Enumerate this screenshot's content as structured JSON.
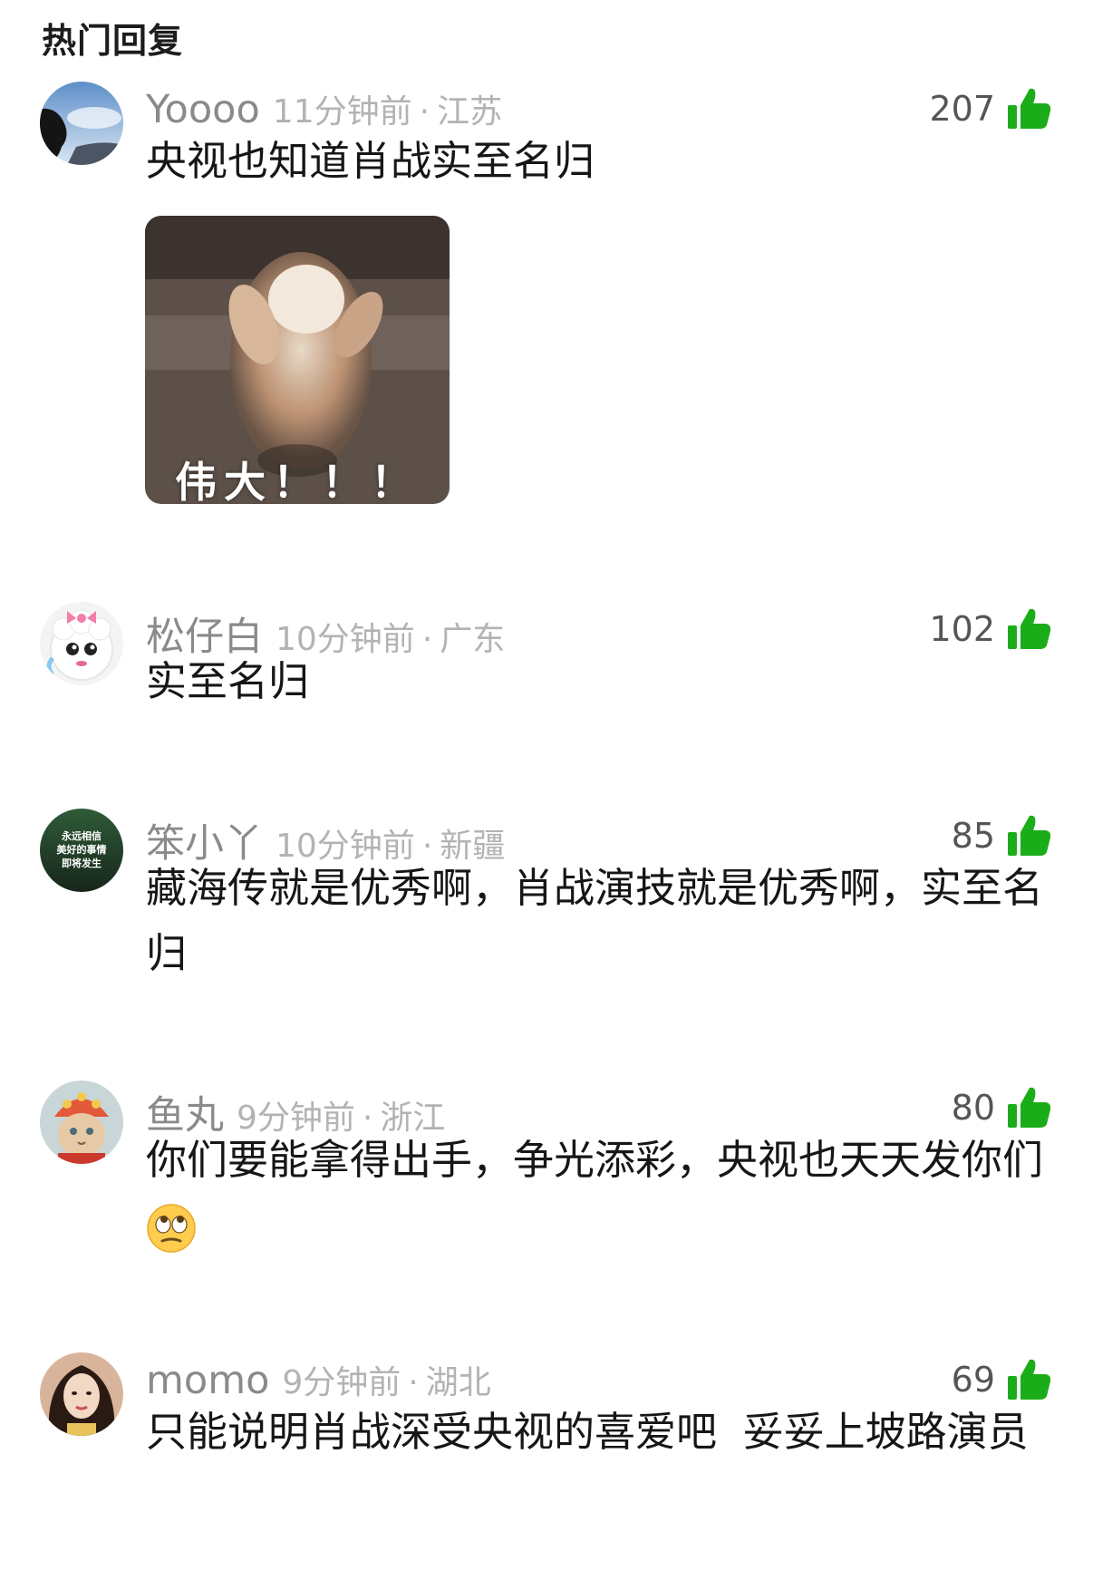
{
  "section_title": "热门回复",
  "colors": {
    "like_green": "#1aad19",
    "username_gray": "#8a8a8a",
    "meta_gray": "#b3b3b3"
  },
  "comments": [
    {
      "username": "Yoooo",
      "time": "11分钟前",
      "dot": "·",
      "location": "江苏",
      "likes": "207",
      "text": "央视也知道肖战实至名归",
      "meme_caption": "伟大！！！",
      "avatar_icon": "silhouette-sky-avatar"
    },
    {
      "username": "松仔白",
      "time": "10分钟前",
      "dot": "·",
      "location": "广东",
      "likes": "102",
      "text": "实至名归",
      "avatar_icon": "cartoon-sheep-avatar"
    },
    {
      "username": "笨小丫",
      "time": "10分钟前",
      "dot": "·",
      "location": "新疆",
      "likes": "85",
      "text": "藏海传就是优秀啊，肖战演技就是优秀啊，实至名归",
      "avatar_text": [
        "永远相信",
        "美好的事情",
        "即将发生"
      ],
      "avatar_icon": "text-motto-avatar"
    },
    {
      "username": "鱼丸",
      "time": "9分钟前",
      "dot": "·",
      "location": "浙江",
      "likes": "80",
      "text": "你们要能拿得出手，争光添彩，央视也天天发你们",
      "avatar_icon": "cat-costume-avatar",
      "trailing_icon": "eye-roll-emoji"
    },
    {
      "username": "momo",
      "time": "9分钟前",
      "dot": "·",
      "location": "湖北",
      "likes": "69",
      "text": "只能说明肖战深受央视的喜爱吧  妥妥上坡路演员",
      "avatar_icon": "portrait-avatar"
    }
  ]
}
